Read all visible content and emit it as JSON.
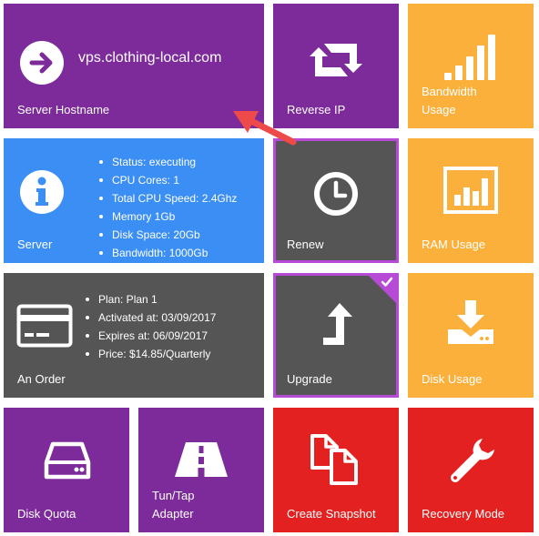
{
  "tiles": {
    "server_hostname": {
      "label": "Server Hostname",
      "value": "vps.clothing-local.com",
      "color": "#7d2a9b"
    },
    "reverse_ip": {
      "label": "Reverse IP",
      "color": "#7d2a9b"
    },
    "bandwidth_usage": {
      "label_line1": "Bandwidth",
      "label_line2": "Usage",
      "color": "#fbb03b"
    },
    "server": {
      "label": "Server",
      "color": "#3b8ef3",
      "details": [
        "Status: executing",
        "CPU Cores: 1",
        "Total CPU Speed: 2.4Ghz",
        "Memory 1Gb",
        "Disk Space: 20Gb",
        "Bandwidth: 1000Gb"
      ]
    },
    "renew": {
      "label": "Renew",
      "color": "#555555"
    },
    "ram_usage": {
      "label": "RAM Usage",
      "color": "#fbb03b"
    },
    "order": {
      "label": "An Order",
      "color": "#555555",
      "details": [
        "Plan: Plan 1",
        "Activated at: 03/09/2017",
        "Expires at: 06/09/2017",
        "Price: $14.85/Quarterly"
      ]
    },
    "upgrade": {
      "label": "Upgrade",
      "color": "#555555",
      "selected": true
    },
    "disk_usage": {
      "label": "Disk Usage",
      "color": "#fbb03b"
    },
    "disk_quota": {
      "label": "Disk Quota",
      "color": "#7d2a9b"
    },
    "tun_tap": {
      "label_line1": "Tun/Tap",
      "label_line2": "Adapter",
      "color": "#7d2a9b"
    },
    "create_snapshot": {
      "label": "Create Snapshot",
      "color": "#e32121"
    },
    "recovery_mode": {
      "label": "Recovery Mode",
      "color": "#e32121"
    }
  },
  "icons": [
    "arrow-right-circle-icon",
    "reverse-arrows-icon",
    "signal-bars-icon",
    "info-icon",
    "clock-icon",
    "bar-chart-icon",
    "credit-card-icon",
    "upgrade-arrow-icon",
    "download-drive-icon",
    "hard-drive-icon",
    "road-icon",
    "copy-icon",
    "wrench-icon",
    "checkmark-icon",
    "pointer-arrow-icon"
  ],
  "accent_colors": {
    "highlight_border": "#b84bd6",
    "pointer_arrow": "#ef4a4a"
  }
}
